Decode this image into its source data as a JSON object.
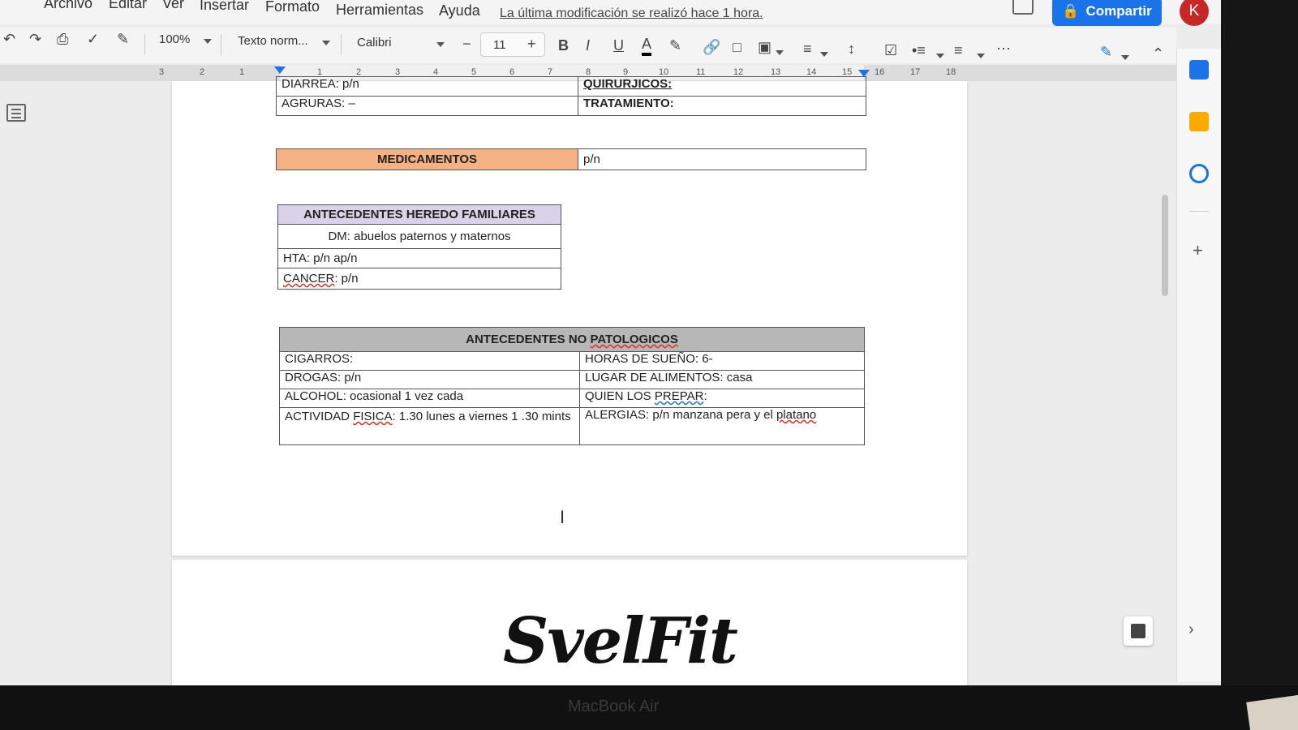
{
  "menu": {
    "items": [
      "Archivo",
      "Editar",
      "Ver",
      "Insertar",
      "Formato",
      "Herramientas",
      "Ayuda"
    ],
    "last_edit": "La última modificación se realizó hace 1 hora.",
    "share_label": "Compartir",
    "avatar_letter": "K"
  },
  "toolbar": {
    "zoom": "100%",
    "style": "Texto norm...",
    "font": "Calibri",
    "font_size": "11",
    "minus": "−",
    "plus": "+",
    "bold": "B",
    "italic": "I",
    "underline": "U",
    "text_color": "A"
  },
  "ruler": {
    "left_numbers": [
      "3",
      "2",
      "1"
    ],
    "numbers": [
      "1",
      "2",
      "3",
      "4",
      "5",
      "6",
      "7",
      "8",
      "9",
      "10",
      "11",
      "12",
      "13",
      "14",
      "15",
      "16",
      "17",
      "18"
    ]
  },
  "doc": {
    "top_table": {
      "row1_left": "DIARREA: p/n",
      "row1_right": "QUIRURJICOS:",
      "row2_left": "AGRURAS: –",
      "row2_right": "TRATAMIENTO:"
    },
    "meds": {
      "header": "MEDICAMENTOS",
      "value": "p/n"
    },
    "hereditary": {
      "header": "ANTECEDENTES  HEREDO FAMILIARES",
      "dm": "DM:  abuelos paternos y maternos",
      "hta": "HTA: p/n ap/n",
      "cancer_label": "CANCER",
      "cancer_value": ": p/n"
    },
    "non_path": {
      "header_a": "ANTECEDENTES  NO ",
      "header_b": "PATOLOGICOS",
      "cigarros": "CIGARROS:",
      "sueno": "HORAS DE SUEÑO: 6-",
      "drogas": "DROGAS: p/n",
      "lugar": "LUGAR  DE ALIMENTOS: casa",
      "alcohol": "ALCOHOL: ocasional 1 vez cada",
      "quien_a": "QUIEN LOS ",
      "quien_b": "PREPAR",
      "quien_c": ":",
      "actividad_a": "ACTIVIDAD ",
      "actividad_b": "FISICA",
      "actividad_c": ": 1.30 lunes a viernes  1 .30 mints",
      "alergias_a": "ALERGIAS: p/n manzana pera y el ",
      "alergias_b": "platano"
    },
    "logo": "SvelFit"
  },
  "device_label": "MacBook Air",
  "colors": {
    "share_blue": "#1a73e8",
    "avatar_red": "#c62828",
    "meds_header": "#f4b183",
    "hereditary_header": "#d9d2e9",
    "nonpath_header": "#b7b7b7"
  }
}
